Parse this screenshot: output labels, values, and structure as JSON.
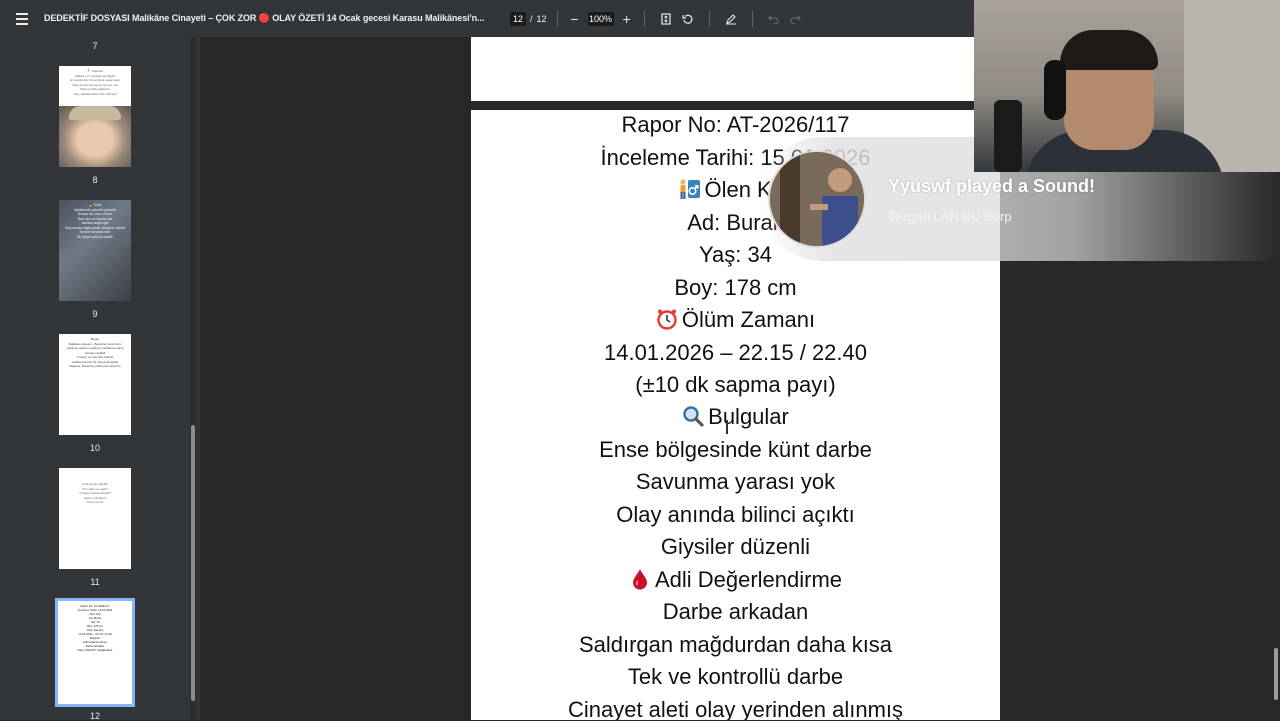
{
  "toolbar": {
    "title": "DEDEKTİF DOSYASI Malikâne Cinayeti – ÇOK ZOR 🔴 OLAY ÖZETİ 14 Ocak gecesi Karasu Malikânesi'n...",
    "current_page": "12",
    "page_separator": "/",
    "total_pages": "12",
    "zoom": "100%",
    "zoom_out": "−",
    "zoom_in": "+"
  },
  "sidebar": {
    "thumbnails": [
      {
        "label": "7"
      },
      {
        "label": "8",
        "text": [
          "📍 Yaşanlar",
          "Maktul o ev içindeki tek kişiydi",
          "Ev içinde ağır bir tartışma yaşanmadı",
          "Olay esnasında ayrıca hiç ses yok",
          "Kapının kilidi sağlamdı",
          "Olay sabaha kadar fark edilmedi"
        ]
      },
      {
        "label": "9",
        "text": [
          "👦 Tutuk",
          "Malikânenin güvenlik görevlisi",
          "Buraya hiç rızası olmadı",
          "Bazı izler ve kanıtlar var",
          "Mutlaka olayla ilgili",
          "Olay anında başka yerde olduğunu söyledi",
          "Kendini korumak ister",
          "Bir şeyler saklıyor olabilir"
        ]
      },
      {
        "label": "10",
        "text": [
          "Başarı",
          "Malikâne çalışanı - Burak'tan kısa boylu",
          "Çalışma odasının yakının anahtarına sahip",
          "Kavgacı değildi",
          "Cinayet sonrasında sakindi",
          "Odada bulunan bir dosya kayboldu",
          "Başkası, Burak ile yüzleşmek istiyordu"
        ]
      },
      {
        "label": "11",
        "text": [
          "Cinayeti kim işledi?",
          "Kim yaptı ve nasıl?",
          "Cinayet nerede işlendi?",
          "Neden mümkün?",
          "Kimin suçu?"
        ]
      },
      {
        "label": "12",
        "text": [
          "Rapor No: AT-2026/117",
          "İnceleme Tarihi: 15.01.2026",
          "Ölen Kişi",
          "Ad: Burak",
          "Yaş: 34",
          "Boy: 178 cm",
          "Ölüm Zamanı",
          "14.01.2026 – 22.15 / 22.40",
          "Bulgular",
          "Adli Değerlendirme",
          "Darbe arkadan",
          "Olay CİNAYET niteliğindedir"
        ]
      }
    ]
  },
  "report": {
    "lines": [
      {
        "text": "Rapor No: AT-2026/117"
      },
      {
        "text": "İnceleme Tarihi: 15.01.2026"
      },
      {
        "text": "Ölen Kişi",
        "icon": "man-icon"
      },
      {
        "text": "Ad: Burak"
      },
      {
        "text": "Yaş: 34"
      },
      {
        "text": "Boy: 178 cm"
      },
      {
        "text": "Ölüm Zamanı",
        "icon": "alarm-clock-icon"
      },
      {
        "text": "14.01.2026 – 22.15 / 22.40"
      },
      {
        "text": "(±10 dk sapma payı)"
      },
      {
        "text": "Bulgular",
        "icon": "magnifier-icon"
      },
      {
        "text": "Ense bölgesinde künt darbe"
      },
      {
        "text": "Savunma yarası yok"
      },
      {
        "text": "Olay anında bilinci açıktı"
      },
      {
        "text": "Giysiler düzenli"
      },
      {
        "text": "Adli Değerlendirme",
        "icon": "blood-drop-icon"
      },
      {
        "text": "Darbe arkadan"
      },
      {
        "text": "Saldırgan mağdurdan daha kısa"
      },
      {
        "text": "Tek ve kontrollü darbe"
      },
      {
        "text": "Cinayet aleti olay yerinden alınmış"
      }
    ]
  },
  "notification": {
    "title": "Yyuswf played a Sound!",
    "subtitle": "Tezgah LAN BU Berp"
  },
  "colors": {
    "toolbar_bg": "#323639",
    "viewer_bg": "#282828",
    "selected_thumb": "#8ab4f8",
    "text": "#111111"
  }
}
